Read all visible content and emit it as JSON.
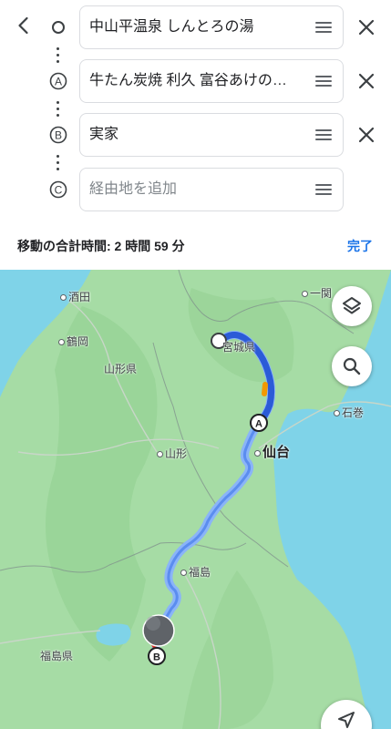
{
  "route_rows": [
    {
      "marker": "○",
      "value": "中山平温泉 しんとろの湯",
      "placeholder": "",
      "close": true
    },
    {
      "marker": "A",
      "value": "牛たん炭焼 利久 富谷あけの…",
      "placeholder": "",
      "close": true
    },
    {
      "marker": "B",
      "value": "実家",
      "placeholder": "",
      "close": true
    },
    {
      "marker": "C",
      "value": "",
      "placeholder": "経由地を追加",
      "close": false
    }
  ],
  "summary": {
    "text": "移動の合計時間: 2 時間 59 分",
    "done_label": "完了"
  },
  "map": {
    "places": [
      {
        "name": "酒田",
        "type": "city"
      },
      {
        "name": "一関",
        "type": "city"
      },
      {
        "name": "鶴岡",
        "type": "city"
      },
      {
        "name": "宮城県",
        "type": "prefecture"
      },
      {
        "name": "山形県",
        "type": "prefecture"
      },
      {
        "name": "石巻",
        "type": "city"
      },
      {
        "name": "山形",
        "type": "city"
      },
      {
        "name": "仙台",
        "type": "major"
      },
      {
        "name": "福島",
        "type": "city"
      },
      {
        "name": "福島県",
        "type": "prefecture"
      }
    ],
    "waypoint_labels": [
      "A",
      "B"
    ],
    "colors": {
      "land": "#a6dca5",
      "sea": "#7fd3e8",
      "route_primary": "#2b5bd7",
      "route_alt": "#8ab4f8",
      "traffic_slow": "#f29900"
    }
  },
  "controls": {
    "icons": [
      "back-arrow-icon",
      "close-icon",
      "drag-handle-icon",
      "layers-icon",
      "search-icon",
      "navigation-icon"
    ]
  }
}
